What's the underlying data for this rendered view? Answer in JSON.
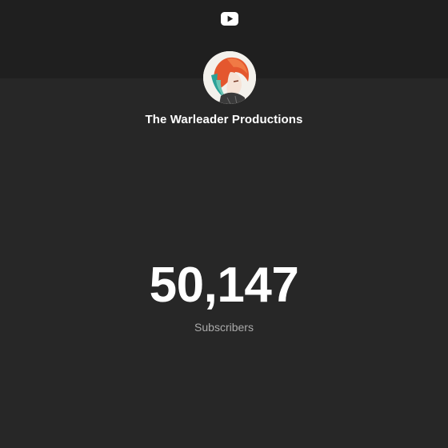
{
  "logo": {
    "icon": "youtube-play-icon",
    "color": "#ffffff"
  },
  "channel": {
    "name": "The Warleader Productions",
    "avatar_icon": "channel-avatar"
  },
  "stats": {
    "subscriber_count": "50,147",
    "subscriber_label": "Subscribers"
  },
  "colors": {
    "background": "#272727",
    "header_band": "#1f1f1f",
    "primary_text": "#ffffff",
    "secondary_text": "#aaaaaa"
  }
}
